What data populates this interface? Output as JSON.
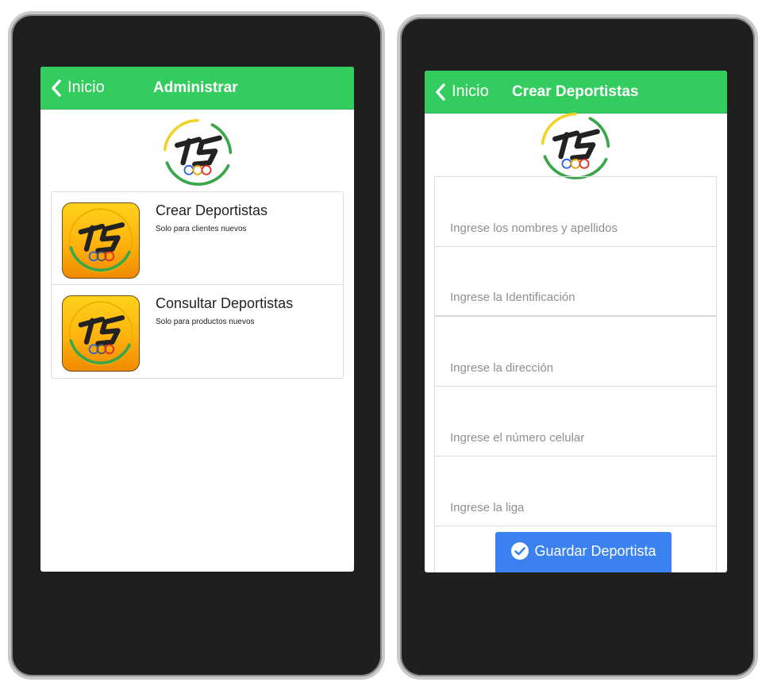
{
  "left_screen": {
    "back_label": "Inicio",
    "title": "Administrar",
    "menu_items": [
      {
        "title": "Crear Deportistas",
        "subtitle": "Solo para clientes nuevos"
      },
      {
        "title": "Consultar Deportistas",
        "subtitle": "Solo para productos nuevos"
      }
    ]
  },
  "right_screen": {
    "back_label": "Inicio",
    "title": "Crear Deportistas",
    "fields": [
      {
        "placeholder": "Ingrese los nombres y apellidos"
      },
      {
        "placeholder": "Ingrese la Identificación"
      },
      {
        "placeholder": "Ingrese la dirección"
      },
      {
        "placeholder": "Ingrese el número celular"
      },
      {
        "placeholder": "Ingrese la liga"
      }
    ],
    "save_label": "Guardar Deportista"
  },
  "colors": {
    "navbar": "#33cc5e",
    "primary_button": "#3b82f0",
    "phone_frame": "#1f1f1f"
  },
  "icons": {
    "back": "chevron-left-icon",
    "logo": "fs-olympic-logo",
    "save": "check-circle-icon"
  }
}
